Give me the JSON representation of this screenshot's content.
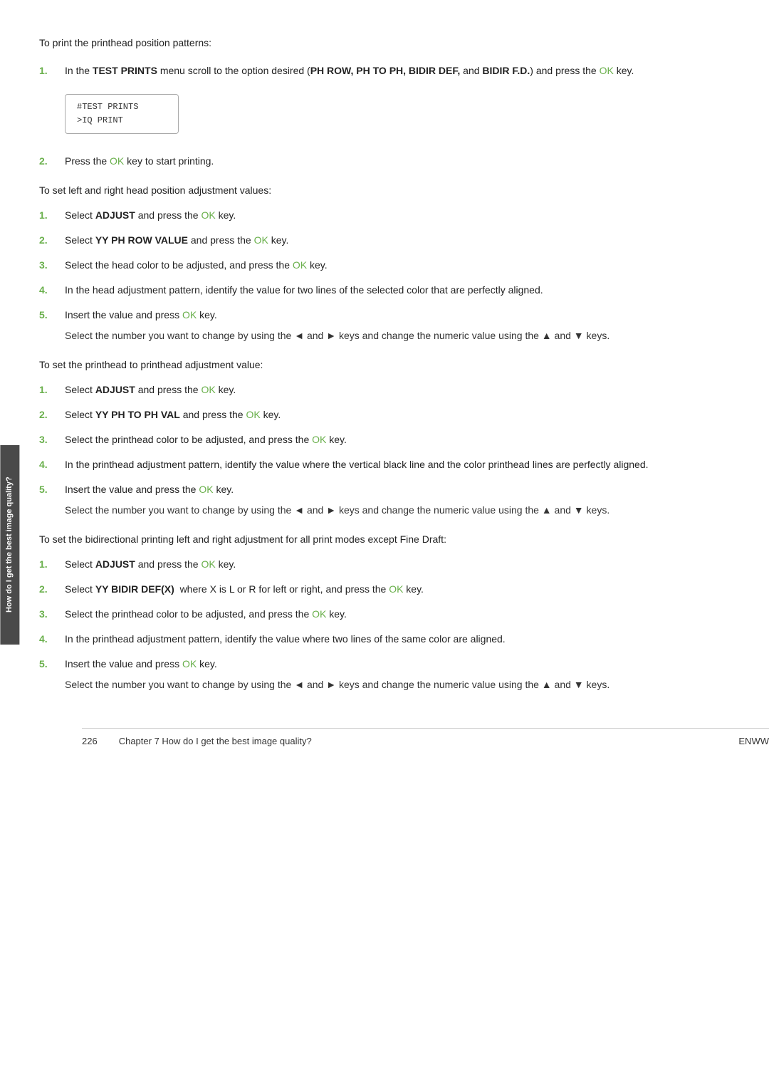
{
  "page": {
    "intro_text": "To print the printhead position patterns:",
    "sections": [
      {
        "id": "section1",
        "steps": [
          {
            "num": "1.",
            "text_parts": [
              {
                "type": "text",
                "content": "In the "
              },
              {
                "type": "bold",
                "content": "TEST PRINTS"
              },
              {
                "type": "text",
                "content": " menu scroll to the option desired ("
              },
              {
                "type": "bold",
                "content": "PH ROW, PH TO PH, BIDIR DEF,"
              },
              {
                "type": "text",
                "content": " and "
              },
              {
                "type": "bold",
                "content": "BIDIR F.D."
              },
              {
                "type": "text",
                "content": ") and press the "
              },
              {
                "type": "ok",
                "content": "OK"
              },
              {
                "type": "text",
                "content": " key."
              }
            ],
            "has_lcd": true,
            "lcd_lines": [
              "#TEST PRINTS",
              ">IQ PRINT"
            ]
          },
          {
            "num": "2.",
            "text_parts": [
              {
                "type": "text",
                "content": "Press the "
              },
              {
                "type": "ok",
                "content": "OK"
              },
              {
                "type": "text",
                "content": " key to start printing."
              }
            ]
          }
        ]
      }
    ],
    "set_left_right_intro": "To set left and right head position adjustment values:",
    "set_left_right_steps": [
      {
        "num": "1.",
        "text_parts": [
          {
            "type": "text",
            "content": "Select "
          },
          {
            "type": "bold",
            "content": "ADJUST"
          },
          {
            "type": "text",
            "content": " and press the "
          },
          {
            "type": "ok",
            "content": "OK"
          },
          {
            "type": "text",
            "content": " key."
          }
        ]
      },
      {
        "num": "2.",
        "text_parts": [
          {
            "type": "text",
            "content": "Select "
          },
          {
            "type": "bold",
            "content": "YY PH ROW VALUE"
          },
          {
            "type": "text",
            "content": " and press the "
          },
          {
            "type": "ok",
            "content": "OK"
          },
          {
            "type": "text",
            "content": " key."
          }
        ]
      },
      {
        "num": "3.",
        "text_parts": [
          {
            "type": "text",
            "content": "Select the head color to be adjusted, and press the "
          },
          {
            "type": "ok",
            "content": "OK"
          },
          {
            "type": "text",
            "content": " key."
          }
        ]
      },
      {
        "num": "4.",
        "text_parts": [
          {
            "type": "text",
            "content": "In the head adjustment pattern, identify the value for two lines of the selected color that are perfectly aligned."
          }
        ]
      },
      {
        "num": "5.",
        "text_parts": [
          {
            "type": "text",
            "content": "Insert the value and press "
          },
          {
            "type": "ok",
            "content": "OK"
          },
          {
            "type": "text",
            "content": " key."
          }
        ],
        "sub_note": "Select the number you want to change by using the ◄ and ► keys and change the numeric value using the ▲ and ▼ keys."
      }
    ],
    "set_printhead_intro": "To set the printhead to printhead adjustment value:",
    "set_printhead_steps": [
      {
        "num": "1.",
        "text_parts": [
          {
            "type": "text",
            "content": "Select "
          },
          {
            "type": "bold",
            "content": "ADJUST"
          },
          {
            "type": "text",
            "content": " and press the "
          },
          {
            "type": "ok",
            "content": "OK"
          },
          {
            "type": "text",
            "content": " key."
          }
        ]
      },
      {
        "num": "2.",
        "text_parts": [
          {
            "type": "text",
            "content": "Select "
          },
          {
            "type": "bold",
            "content": "YY PH TO PH VAL"
          },
          {
            "type": "text",
            "content": " and press the "
          },
          {
            "type": "ok",
            "content": "OK"
          },
          {
            "type": "text",
            "content": " key."
          }
        ]
      },
      {
        "num": "3.",
        "text_parts": [
          {
            "type": "text",
            "content": "Select the printhead color to be adjusted, and press the "
          },
          {
            "type": "ok",
            "content": "OK"
          },
          {
            "type": "text",
            "content": " key."
          }
        ]
      },
      {
        "num": "4.",
        "text_parts": [
          {
            "type": "text",
            "content": "In the printhead adjustment pattern, identify the value where the vertical black line and the color printhead lines are perfectly aligned."
          }
        ]
      },
      {
        "num": "5.",
        "text_parts": [
          {
            "type": "text",
            "content": "Insert the value and press the "
          },
          {
            "type": "ok",
            "content": "OK"
          },
          {
            "type": "text",
            "content": " key."
          }
        ],
        "sub_note": "Select the number you want to change by using the ◄ and ► keys and change the numeric value using the ▲ and ▼ keys."
      }
    ],
    "set_bidir_intro": "To set the bidirectional printing left and right adjustment for all print modes except Fine Draft:",
    "set_bidir_steps": [
      {
        "num": "1.",
        "text_parts": [
          {
            "type": "text",
            "content": "Select "
          },
          {
            "type": "bold",
            "content": "ADJUST"
          },
          {
            "type": "text",
            "content": " and press the "
          },
          {
            "type": "ok",
            "content": "OK"
          },
          {
            "type": "text",
            "content": " key."
          }
        ]
      },
      {
        "num": "2.",
        "text_parts": [
          {
            "type": "text",
            "content": "Select "
          },
          {
            "type": "bold",
            "content": "YY BIDIR DEF(X)"
          },
          {
            "type": "text",
            "content": "  where X is L or R for left or right, and press the "
          },
          {
            "type": "ok",
            "content": "OK"
          },
          {
            "type": "text",
            "content": " key."
          }
        ]
      },
      {
        "num": "3.",
        "text_parts": [
          {
            "type": "text",
            "content": "Select the printhead color to be adjusted, and press the "
          },
          {
            "type": "ok",
            "content": "OK"
          },
          {
            "type": "text",
            "content": " key."
          }
        ]
      },
      {
        "num": "4.",
        "text_parts": [
          {
            "type": "text",
            "content": "In the printhead adjustment pattern, identify the value where two lines of the same color are aligned."
          }
        ]
      },
      {
        "num": "5.",
        "text_parts": [
          {
            "type": "text",
            "content": "Insert the value and press "
          },
          {
            "type": "ok",
            "content": "OK"
          },
          {
            "type": "text",
            "content": " key."
          }
        ],
        "sub_note": "Select the number you want to change by using the ◄ and ► keys and change the numeric value using the ▲ and ▼ keys."
      }
    ],
    "footer": {
      "page_number": "226",
      "chapter_text": "Chapter 7   How do I get the best image quality?",
      "right_text": "ENWW"
    },
    "side_label": "How do I get the best image quality?"
  }
}
